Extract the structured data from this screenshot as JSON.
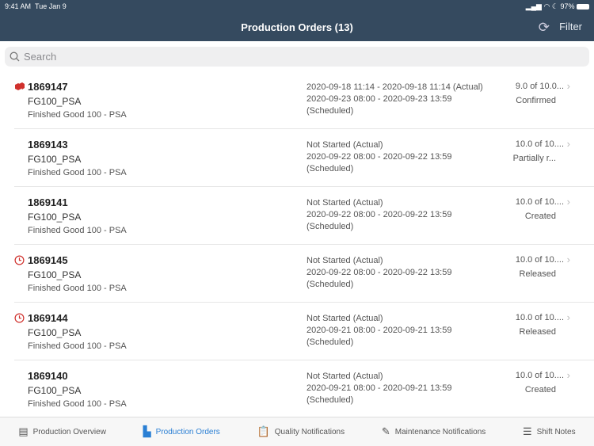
{
  "status": {
    "time": "9:41 AM",
    "date": "Tue Jan 9",
    "battery": "97%"
  },
  "header": {
    "title": "Production Orders (13)",
    "filter": "Filter"
  },
  "search": {
    "placeholder": "Search"
  },
  "orders": [
    {
      "id": "1869147",
      "material": "FG100_PSA",
      "description": "Finished Good 100 - PSA",
      "line1": "2020-09-18 11:14 - 2020-09-18 11:14 (Actual)",
      "line2": "2020-09-23 08:00 - 2020-09-23 13:59",
      "line3": "(Scheduled)",
      "qty": "9.0 of 10.0...",
      "status": "Confirmed",
      "icon": "cubes-icon"
    },
    {
      "id": "1869143",
      "material": "FG100_PSA",
      "description": "Finished Good 100 - PSA",
      "line1": "Not Started (Actual)",
      "line2": "2020-09-22 08:00 - 2020-09-22 13:59",
      "line3": "(Scheduled)",
      "qty": "10.0 of 10....",
      "status": "Partially r...",
      "icon": ""
    },
    {
      "id": "1869141",
      "material": "FG100_PSA",
      "description": "Finished Good 100 - PSA",
      "line1": "Not Started (Actual)",
      "line2": "2020-09-22 08:00 - 2020-09-22 13:59",
      "line3": "(Scheduled)",
      "qty": "10.0 of 10....",
      "status": "Created",
      "icon": ""
    },
    {
      "id": "1869145",
      "material": "FG100_PSA",
      "description": "Finished Good 100 - PSA",
      "line1": "Not Started (Actual)",
      "line2": "2020-09-22 08:00 - 2020-09-22 13:59",
      "line3": "(Scheduled)",
      "qty": "10.0 of 10....",
      "status": "Released",
      "icon": "clock-icon"
    },
    {
      "id": "1869144",
      "material": "FG100_PSA",
      "description": "Finished Good 100 - PSA",
      "line1": "Not Started (Actual)",
      "line2": "2020-09-21 08:00 - 2020-09-21 13:59",
      "line3": "(Scheduled)",
      "qty": "10.0 of 10....",
      "status": "Released",
      "icon": "clock-icon"
    },
    {
      "id": "1869140",
      "material": "FG100_PSA",
      "description": "Finished Good 100 - PSA",
      "line1": "Not Started (Actual)",
      "line2": "2020-09-21 08:00 - 2020-09-21 13:59",
      "line3": "(Scheduled)",
      "qty": "10.0 of 10....",
      "status": "Created",
      "icon": ""
    }
  ],
  "tabs": [
    {
      "label": "Production Overview",
      "icon": "report-icon",
      "glyph": "▤"
    },
    {
      "label": "Production Orders",
      "icon": "factory-icon",
      "glyph": "▙",
      "active": true
    },
    {
      "label": "Quality Notifications",
      "icon": "clipboard-icon",
      "glyph": "📋"
    },
    {
      "label": "Maintenance Notifications",
      "icon": "edit-document-icon",
      "glyph": "✎"
    },
    {
      "label": "Shift Notes",
      "icon": "notes-icon",
      "glyph": "☰"
    }
  ],
  "colors": {
    "header": "#354a5f",
    "accent": "#2a7fd4",
    "alert": "#d0312d"
  }
}
